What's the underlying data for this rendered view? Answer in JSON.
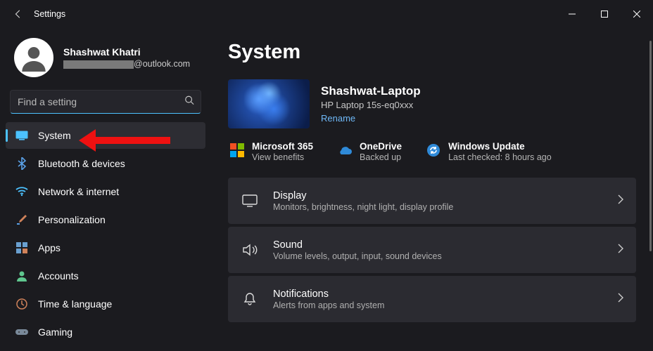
{
  "title": "Settings",
  "profile": {
    "name": "Shashwat Khatri",
    "email_suffix": "@outlook.com"
  },
  "search": {
    "placeholder": "Find a setting"
  },
  "nav": [
    {
      "label": "System"
    },
    {
      "label": "Bluetooth & devices"
    },
    {
      "label": "Network & internet"
    },
    {
      "label": "Personalization"
    },
    {
      "label": "Apps"
    },
    {
      "label": "Accounts"
    },
    {
      "label": "Time & language"
    },
    {
      "label": "Gaming"
    }
  ],
  "page_heading": "System",
  "device": {
    "name": "Shashwat-Laptop",
    "model": "HP Laptop 15s-eq0xxx",
    "rename": "Rename"
  },
  "status": {
    "m365": {
      "title": "Microsoft 365",
      "sub": "View benefits"
    },
    "onedrive": {
      "title": "OneDrive",
      "sub": "Backed up"
    },
    "wu": {
      "title": "Windows Update",
      "sub": "Last checked: 8 hours ago"
    }
  },
  "cards": [
    {
      "title": "Display",
      "sub": "Monitors, brightness, night light, display profile"
    },
    {
      "title": "Sound",
      "sub": "Volume levels, output, input, sound devices"
    },
    {
      "title": "Notifications",
      "sub": "Alerts from apps and system"
    }
  ]
}
